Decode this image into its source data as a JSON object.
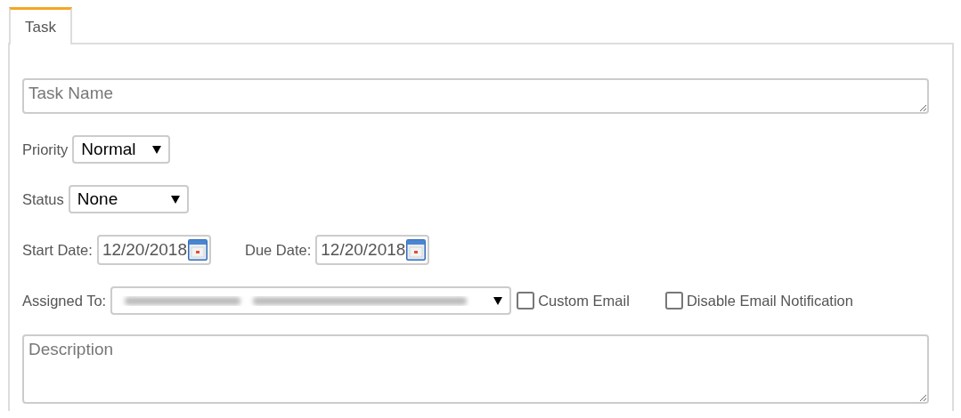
{
  "tabs": [
    {
      "label": "Task",
      "selected": true
    }
  ],
  "task_name": {
    "placeholder": "Task Name"
  },
  "priority": {
    "label": "Priority",
    "value": "Normal"
  },
  "status": {
    "label": "Status",
    "value": "None"
  },
  "start_date": {
    "label": "Start Date:",
    "value": "12/20/2018"
  },
  "due_date": {
    "label": "Due Date:",
    "value": "12/20/2018"
  },
  "assigned_to": {
    "label": "Assigned To:",
    "redacted": true
  },
  "options": [
    {
      "label": "Custom Email",
      "checked": false
    },
    {
      "label": "Disable Email Notification",
      "checked": false
    }
  ],
  "description": {
    "placeholder": "Description"
  }
}
